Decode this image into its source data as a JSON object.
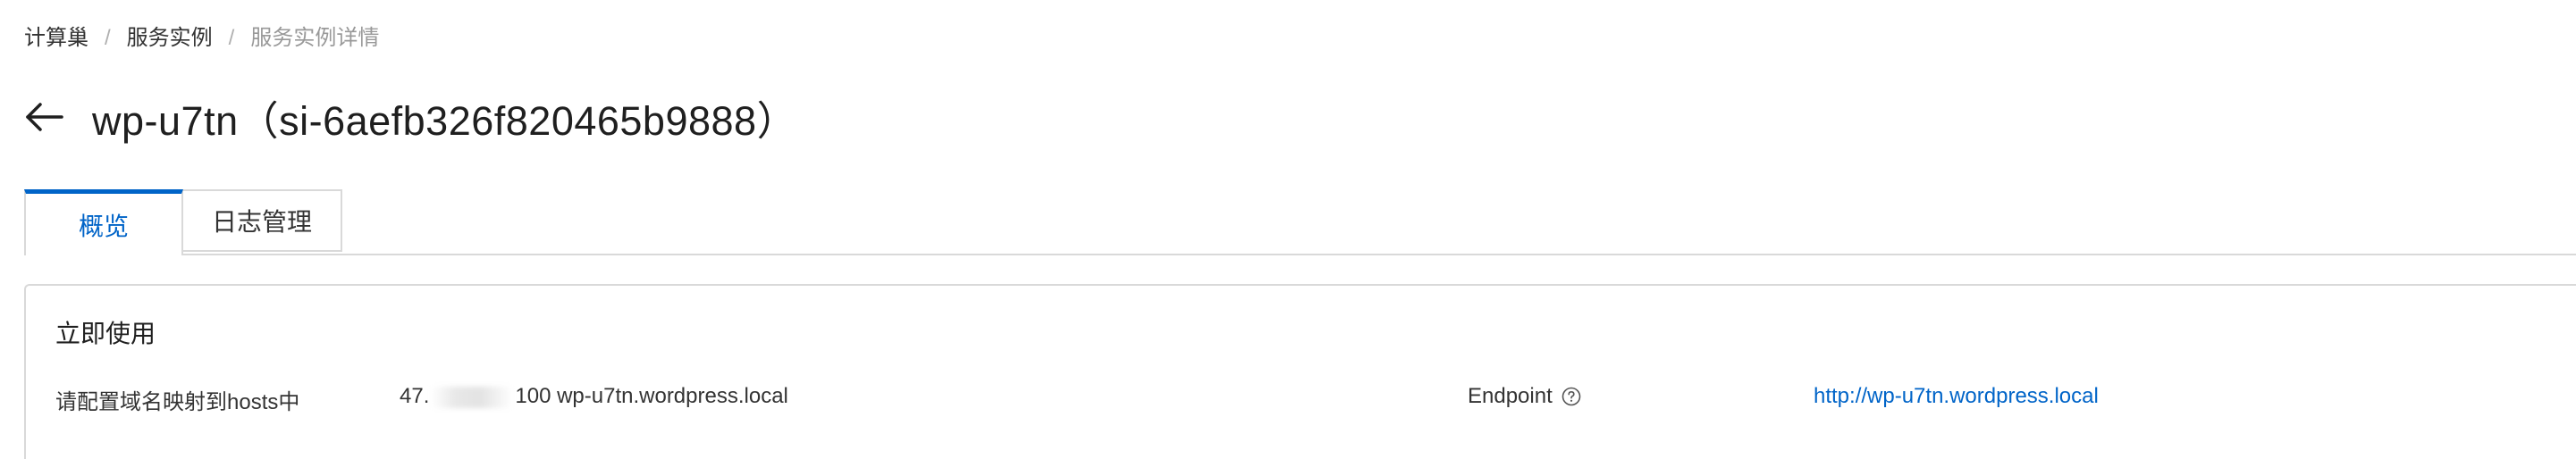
{
  "breadcrumb": {
    "items": [
      "计算巢",
      "服务实例",
      "服务实例详情"
    ],
    "separator": "/"
  },
  "header": {
    "back_icon": "arrow-left-icon",
    "title": "wp-u7tn（si-6aefb326f820465b9888）"
  },
  "tabs": [
    {
      "label": "概览",
      "active": true
    },
    {
      "label": "日志管理",
      "active": false
    }
  ],
  "card": {
    "title": "立即使用",
    "hosts": {
      "label": "请配置域名映射到hosts中",
      "value_prefix": "47.",
      "value_suffix": "100 wp-u7tn.wordpress.local"
    },
    "endpoint": {
      "label": "Endpoint",
      "help_icon": "question-circle-icon",
      "link": "http://wp-u7tn.wordpress.local"
    }
  },
  "colors": {
    "accent": "#0064c8",
    "border": "#d9d9d9",
    "text": "#333333",
    "muted": "#999999"
  }
}
